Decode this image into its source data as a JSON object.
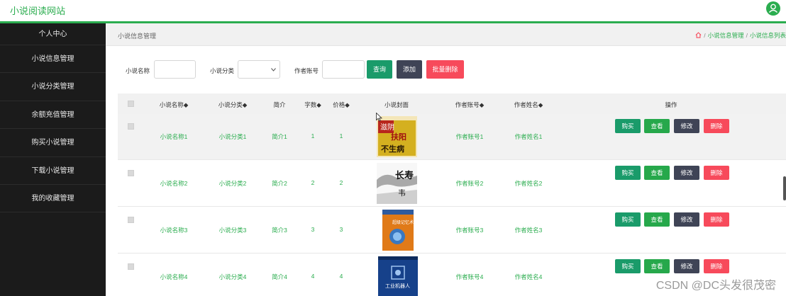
{
  "header": {
    "title": "小说阅读网站",
    "user_icon": "user-icon"
  },
  "sidebar": {
    "items": [
      "个人中心",
      "小说信息管理",
      "小说分类管理",
      "余额充值管理",
      "购买小说管理",
      "下载小说管理",
      "我的收藏管理"
    ]
  },
  "breadcrumb": {
    "title": "小说信息管理",
    "path": [
      "小说信息管理",
      "小说信息列表"
    ]
  },
  "search": {
    "name_label": "小说名称",
    "category_label": "小说分类",
    "author_label": "作者账号",
    "query_label": "查询",
    "add_label": "添加",
    "batch_delete_label": "批量删除"
  },
  "table": {
    "headers": {
      "name": "小说名称◆",
      "category": "小说分类◆",
      "intro": "简介",
      "words": "字数◆",
      "price": "价格◆",
      "cover": "小说封面",
      "author_account": "作者账号◆",
      "author_name": "作者姓名◆",
      "actions": "操作"
    },
    "rows": [
      {
        "name": "小说名称1",
        "category": "小说分类1",
        "intro": "简介1",
        "words": "1",
        "price": "1",
        "author_account": "作者账号1",
        "author_name": "作者姓名1"
      },
      {
        "name": "小说名称2",
        "category": "小说分类2",
        "intro": "简介2",
        "words": "2",
        "price": "2",
        "author_account": "作者账号2",
        "author_name": "作者姓名2"
      },
      {
        "name": "小说名称3",
        "category": "小说分类3",
        "intro": "简介3",
        "words": "3",
        "price": "3",
        "author_account": "作者账号3",
        "author_name": "作者姓名3"
      },
      {
        "name": "小说名称4",
        "category": "小说分类4",
        "intro": "简介4",
        "words": "4",
        "price": "4",
        "author_account": "作者账号4",
        "author_name": "作者姓名4"
      }
    ],
    "actions": {
      "buy": "购买",
      "view": "查看",
      "edit": "修改",
      "delete": "删除"
    },
    "covers": [
      {
        "text_top": "滋阴",
        "text_main": "扶阳",
        "text_sub": "不生病"
      },
      {
        "text_main": "长寿",
        "text_sub": "韦"
      },
      {
        "text_main": "超级记忆术"
      },
      {
        "text_main": "工业机器人"
      }
    ]
  },
  "watermark": "CSDN @DC头发很茂密",
  "colors": {
    "accent": "#2bad4f",
    "sidebar_bg": "#1b1b1b",
    "query": "#1a9b6a",
    "add": "#3f4456",
    "delete": "#f74a5b"
  }
}
